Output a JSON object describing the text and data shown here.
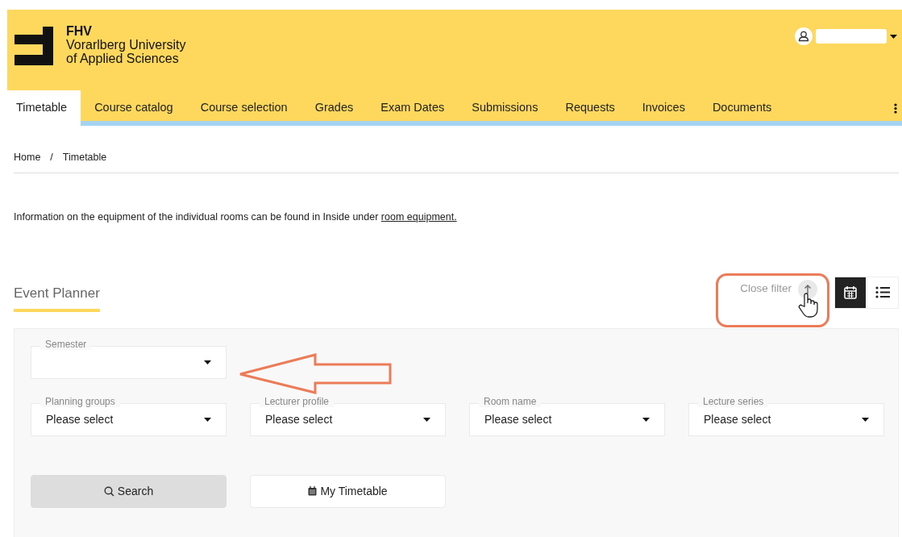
{
  "header": {
    "logo": {
      "acronym": "FHV",
      "line_1": "Vorarlberg University",
      "line_2": "of Applied Sciences"
    }
  },
  "tabs": [
    {
      "label": "Timetable",
      "selected": true
    },
    {
      "label": "Course catalog",
      "selected": false
    },
    {
      "label": "Course selection",
      "selected": false
    },
    {
      "label": "Grades",
      "selected": false
    },
    {
      "label": "Exam Dates",
      "selected": false
    },
    {
      "label": "Submissions",
      "selected": false
    },
    {
      "label": "Requests",
      "selected": false
    },
    {
      "label": "Invoices",
      "selected": false
    },
    {
      "label": "Documents",
      "selected": false
    }
  ],
  "breadcrumb": [
    "Home",
    "Timetable"
  ],
  "breadcrumb_separator": "/",
  "info": {
    "text": "Information on the equipment of the individual rooms can be found in Inside under",
    "link": "room equipment."
  },
  "section_title": "Event Planner",
  "close_filter": "Close filter",
  "views": [
    {
      "kind": "calendar",
      "selected": true
    },
    {
      "kind": "list",
      "selected": false
    }
  ],
  "filters": [
    {
      "label": "Semester"
    },
    {
      "label": "Planning groups",
      "value": "Please select"
    },
    {
      "label": "Lecturer profile",
      "value": "Please select"
    },
    {
      "label": "Room name",
      "value": "Please select"
    },
    {
      "label": "Lecture series",
      "value": "Please select"
    }
  ],
  "buttons": [
    {
      "kind": "search",
      "label": "Search"
    },
    {
      "kind": "timetable",
      "label": "My Timetable"
    }
  ]
}
